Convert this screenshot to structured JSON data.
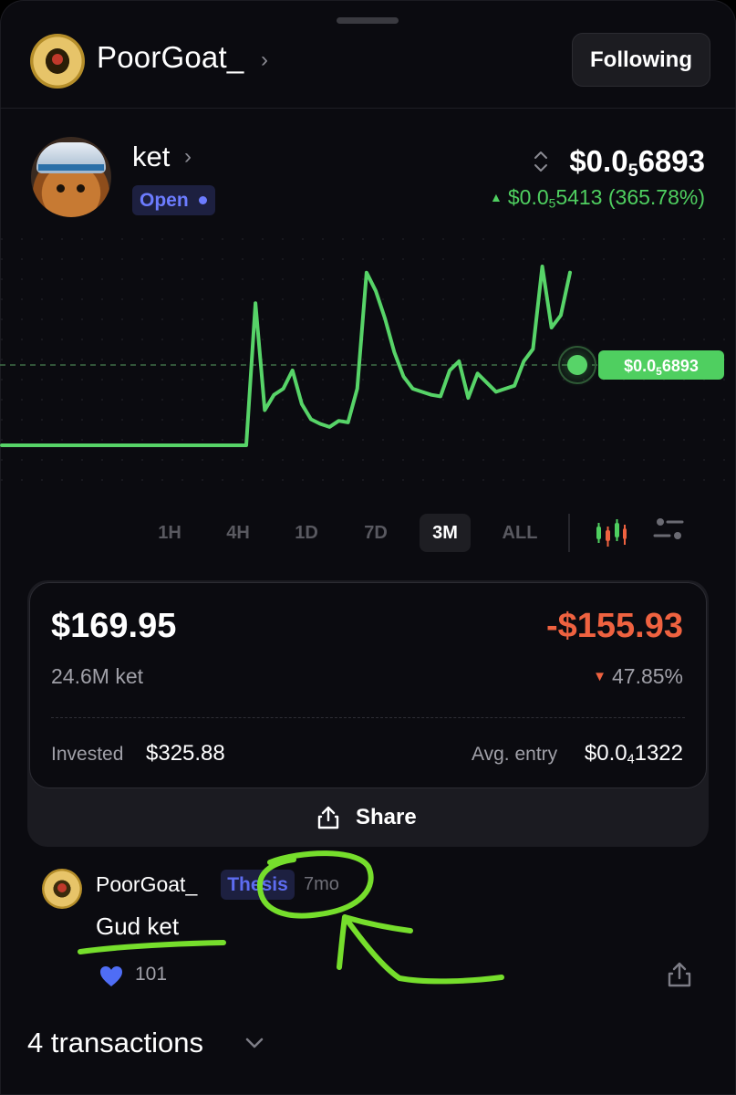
{
  "header": {
    "username": "PoorGoat_",
    "follow_label": "Following"
  },
  "token": {
    "name": "ket",
    "status": "Open",
    "price_main": "$0.0",
    "price_zeros": "5",
    "price_tail": "6893",
    "change_main": "$0.0",
    "change_zeros": "5",
    "change_tail": "5413 (365.78%)",
    "change_direction": "up",
    "accent_up": "#4fcf60",
    "accent_down": "#ef6240"
  },
  "chart": {
    "price_tag_main": "$0.0",
    "price_tag_zeros": "5",
    "price_tag_tail": "6893",
    "timeframes": [
      "1H",
      "4H",
      "1D",
      "7D",
      "3M",
      "ALL"
    ],
    "active_timeframe": "3M",
    "icons": [
      "candlestick-icon",
      "chart-settings-icon"
    ]
  },
  "chart_data": {
    "type": "line",
    "values": [
      1.15,
      1.15,
      1.15,
      1.15,
      1.15,
      1.15,
      1.15,
      1.15,
      1.15,
      1.15,
      1.15,
      1.15,
      1.15,
      1.15,
      1.15,
      1.15,
      1.15,
      1.15,
      5.8,
      2.3,
      2.8,
      3.0,
      3.6,
      2.5,
      2.0,
      1.85,
      1.75,
      1.95,
      1.9,
      3.0,
      6.8,
      6.2,
      5.3,
      4.2,
      3.4,
      3.0,
      2.9,
      2.8,
      2.75,
      3.6,
      3.9,
      2.7,
      3.5,
      3.2,
      2.9,
      3.0,
      3.1,
      3.9,
      4.3,
      7.0,
      5.0,
      5.4,
      6.8
    ],
    "last_price_label": "$0.0₅6893",
    "grid": true
  },
  "position": {
    "value": "$169.95",
    "pnl": "-$155.93",
    "amount": "24.6M ket",
    "pnl_pct": "47.85%",
    "invested_label": "Invested",
    "invested_value": "$325.88",
    "avg_entry_label": "Avg. entry",
    "avg_entry_main": "$0.0",
    "avg_entry_zeros": "4",
    "avg_entry_tail": "1322",
    "share_label": "Share"
  },
  "comment": {
    "username": "PoorGoat_",
    "tag": "Thesis",
    "time": "7mo",
    "text": "Gud ket",
    "likes": "101"
  },
  "transactions": {
    "label": "4 transactions"
  }
}
